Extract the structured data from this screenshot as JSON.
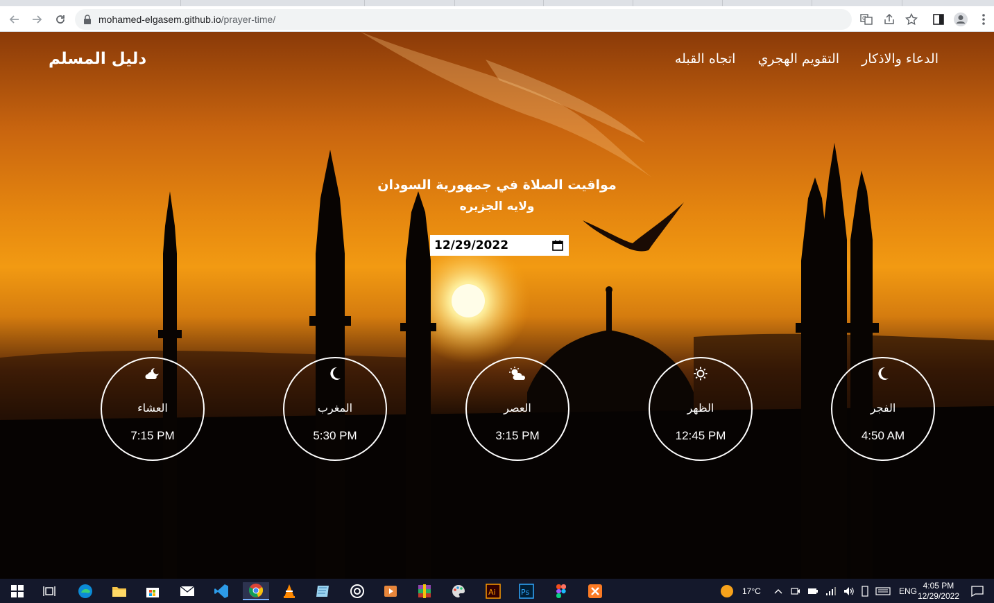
{
  "browser": {
    "url_host": "mohamed-elgasem.github.io",
    "url_path": "/prayer-time/"
  },
  "site": {
    "brand": "دليل المسلم",
    "nav": [
      "الدعاء والاذكار",
      "التقويم الهجري",
      "اتجاه القبله"
    ]
  },
  "main": {
    "title": "مواقيت الصلاة في جمهورية السودان",
    "subtitle": "ولايه الجزيره",
    "date_value": "12/29/2022"
  },
  "prayers": [
    {
      "name": "العشاء",
      "time": "7:15 PM",
      "icon": "cloud-moon-icon"
    },
    {
      "name": "المغرب",
      "time": "5:30 PM",
      "icon": "moon-icon"
    },
    {
      "name": "العصر",
      "time": "3:15 PM",
      "icon": "cloud-sun-icon"
    },
    {
      "name": "الظهر",
      "time": "12:45 PM",
      "icon": "sun-icon"
    },
    {
      "name": "الفجر",
      "time": "4:50 AM",
      "icon": "moon-icon"
    }
  ],
  "taskbar": {
    "weather": "17°C",
    "language": "ENG",
    "time": "4:05 PM",
    "date": "12/29/2022"
  }
}
